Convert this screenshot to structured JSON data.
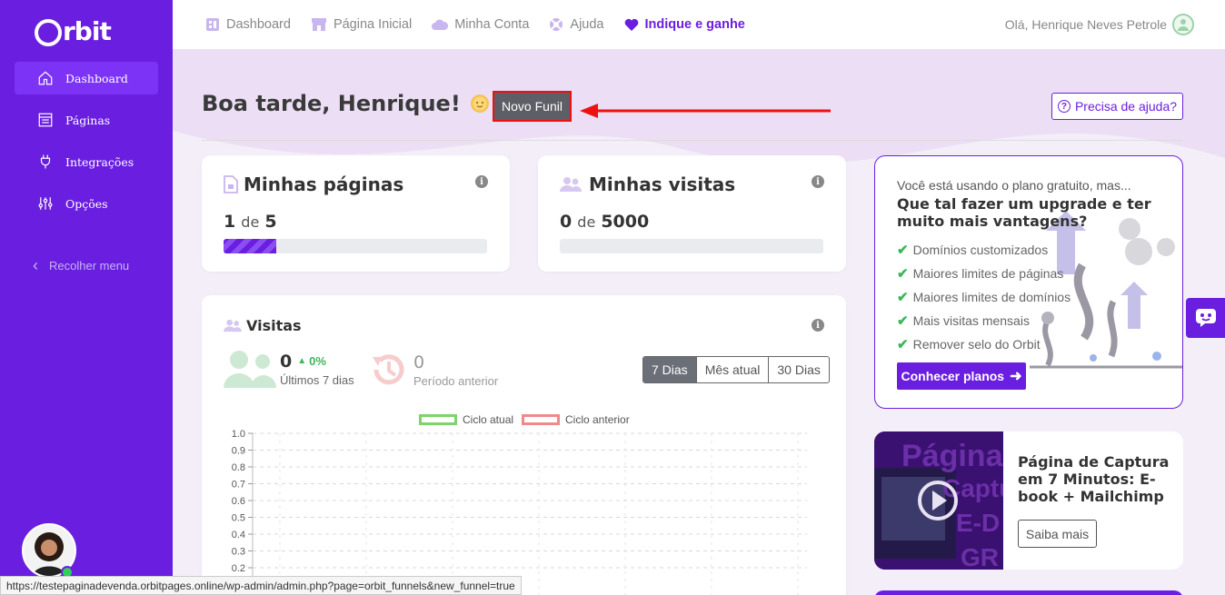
{
  "brand": {
    "name": "rbit",
    "accent": "#6a1ee0"
  },
  "sidebar": {
    "items": [
      {
        "label": "Dashboard",
        "icon": "home-icon",
        "active": true
      },
      {
        "label": "Páginas",
        "icon": "pages-icon"
      },
      {
        "label": "Integrações",
        "icon": "plug-icon"
      },
      {
        "label": "Opções",
        "icon": "sliders-icon"
      }
    ],
    "collapse_label": "Recolher menu"
  },
  "topbar": {
    "links": [
      {
        "label": "Dashboard",
        "icon": "dashboard-icon"
      },
      {
        "label": "Página Inicial",
        "icon": "store-icon"
      },
      {
        "label": "Minha Conta",
        "icon": "cloud-icon"
      },
      {
        "label": "Ajuda",
        "icon": "lifebuoy-icon"
      },
      {
        "label": "Indique e ganhe",
        "icon": "heart-icon"
      }
    ],
    "greeting": "Olá, Henrique Neves Petrole"
  },
  "header": {
    "title": "Boa tarde, Henrique!",
    "new_funnel_label": "Novo Funil",
    "help_label": "Precisa de ajuda?"
  },
  "pages_card": {
    "title": "Minhas páginas",
    "used": "1",
    "sep": "de",
    "limit": "5",
    "progress": 0.2
  },
  "visits_card": {
    "title": "Minhas visitas",
    "used": "0",
    "sep": "de",
    "limit": "5000",
    "progress": 0
  },
  "visits_chart_card": {
    "title": "Visitas",
    "current": {
      "value": "0",
      "change": "0%",
      "label": "Últimos 7 dias"
    },
    "previous": {
      "value": "0",
      "label": "Período anterior"
    },
    "ranges": [
      "7 Dias",
      "Mês atual",
      "30 Dias"
    ],
    "selected_range": "7 Dias"
  },
  "chart_data": {
    "type": "line",
    "series": [
      {
        "name": "Ciclo atual",
        "color": "#7ed36b",
        "values": []
      },
      {
        "name": "Ciclo anterior",
        "color": "#f08a8a",
        "values": []
      }
    ],
    "ylim": [
      0,
      1.0
    ],
    "yticks": [
      "1.0",
      "0.9",
      "0.8",
      "0.7",
      "0.6",
      "0.5",
      "0.4",
      "0.3",
      "0.2"
    ],
    "grid": true,
    "legend": "top"
  },
  "upgrade_card": {
    "intro": "Você está usando o plano gratuito, mas...",
    "headline": "Que tal fazer um upgrade e ter muito mais vantagens?",
    "features": [
      "Domínios customizados",
      "Maiores limites de páginas",
      "Maiores limites de domínios",
      "Mais visitas mensais",
      "Remover selo do Orbit"
    ],
    "cta": "Conhecer planos"
  },
  "video_card": {
    "title": "Página de Captura em 7 Minutos: E-book + Mailchimp",
    "button": "Saiba mais",
    "thumb_words": [
      "Página",
      "Captu",
      "E-D",
      "GR"
    ]
  },
  "statusbar": {
    "url": "https://testepaginadevenda.orbitpages.online/wp-admin/admin.php?page=orbit_funnels&new_funnel=true"
  }
}
